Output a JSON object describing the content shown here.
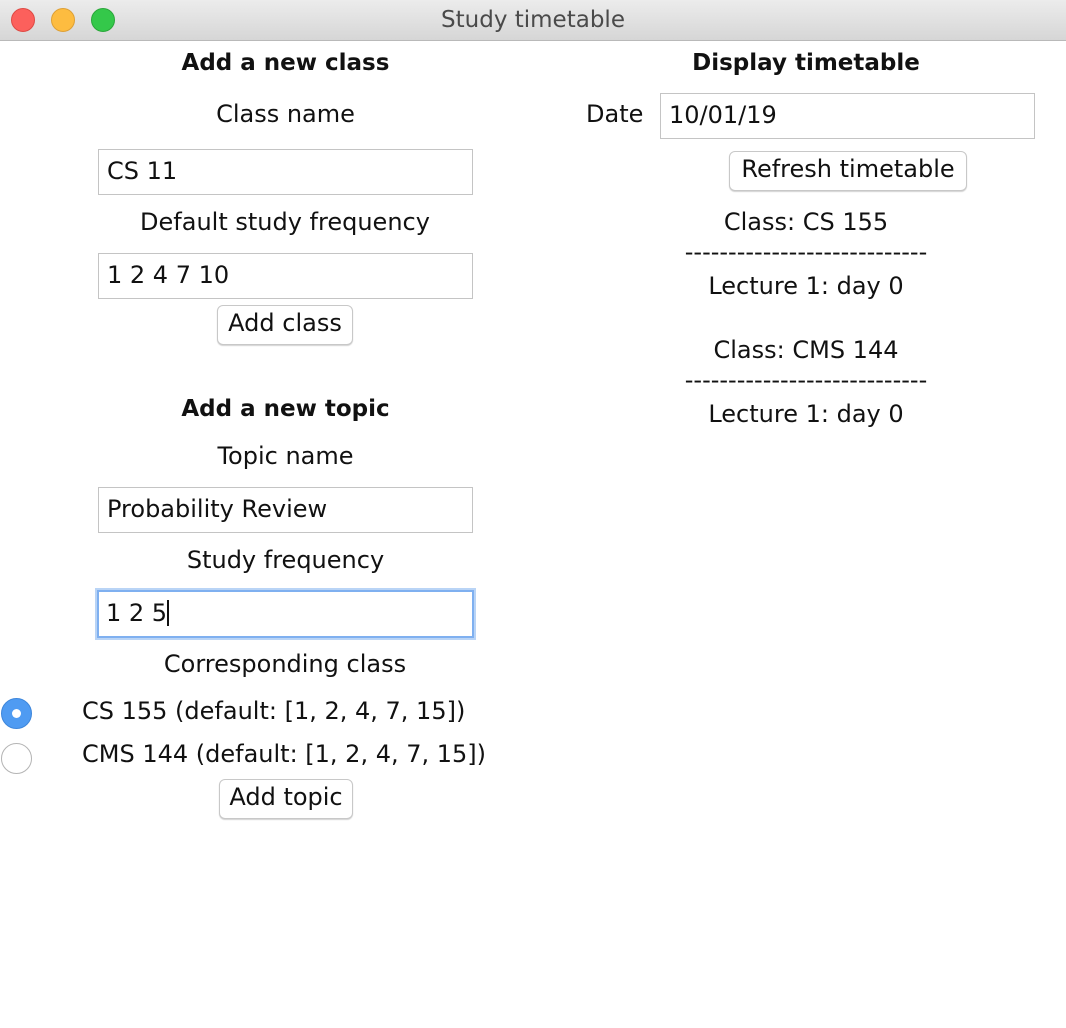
{
  "window": {
    "title": "Study timetable"
  },
  "add_class": {
    "heading": "Add a new class",
    "class_name_label": "Class name",
    "class_name_value": "CS 11",
    "frequency_label": "Default study frequency",
    "frequency_value": "1 2 4 7 10",
    "button": "Add class"
  },
  "add_topic": {
    "heading": "Add a new topic",
    "topic_name_label": "Topic name",
    "topic_name_value": "Probability Review",
    "frequency_label": "Study frequency",
    "frequency_value": "1 2 5",
    "class_label": "Corresponding class",
    "classes": [
      {
        "label": "CS 155 (default: [1, 2, 4, 7, 15])",
        "selected": true
      },
      {
        "label": "CMS 144 (default: [1, 2, 4, 7, 15])",
        "selected": false
      }
    ],
    "button": "Add topic"
  },
  "display": {
    "heading": "Display timetable",
    "date_label": "Date",
    "date_value": "10/01/19",
    "refresh_button": "Refresh timetable",
    "entries": [
      {
        "class_line": "Class: CS 155",
        "separator": "----------------------------",
        "lecture": "Lecture 1: day 0"
      },
      {
        "class_line": "Class: CMS 144",
        "separator": "----------------------------",
        "lecture": "Lecture 1: day 0"
      }
    ]
  }
}
